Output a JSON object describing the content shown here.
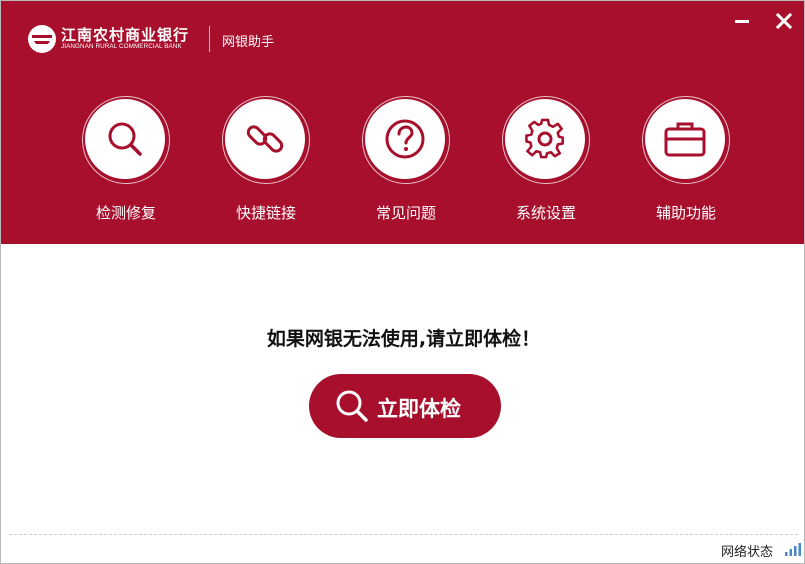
{
  "colors": {
    "brand_red": "#a70f2c",
    "white": "#ffffff"
  },
  "header": {
    "logo_cn": "江南农村商业银行",
    "logo_en": "JIANGNAN RURAL COMMERCIAL BANK",
    "app_title": "网银助手"
  },
  "window_controls": {
    "minimize_icon": "minimize-icon",
    "close_icon": "close-icon"
  },
  "features": [
    {
      "label": "检测修复",
      "icon": "search-icon"
    },
    {
      "label": "快捷链接",
      "icon": "link-icon"
    },
    {
      "label": "常见问题",
      "icon": "question-icon"
    },
    {
      "label": "系统设置",
      "icon": "gear-icon"
    },
    {
      "label": "辅助功能",
      "icon": "toolbox-icon"
    }
  ],
  "main": {
    "prompt": "如果网银无法使用,请立即体检！",
    "check_button": "立即体检"
  },
  "footer": {
    "network_status": "网络状态",
    "signal_icon": "signal-icon"
  }
}
